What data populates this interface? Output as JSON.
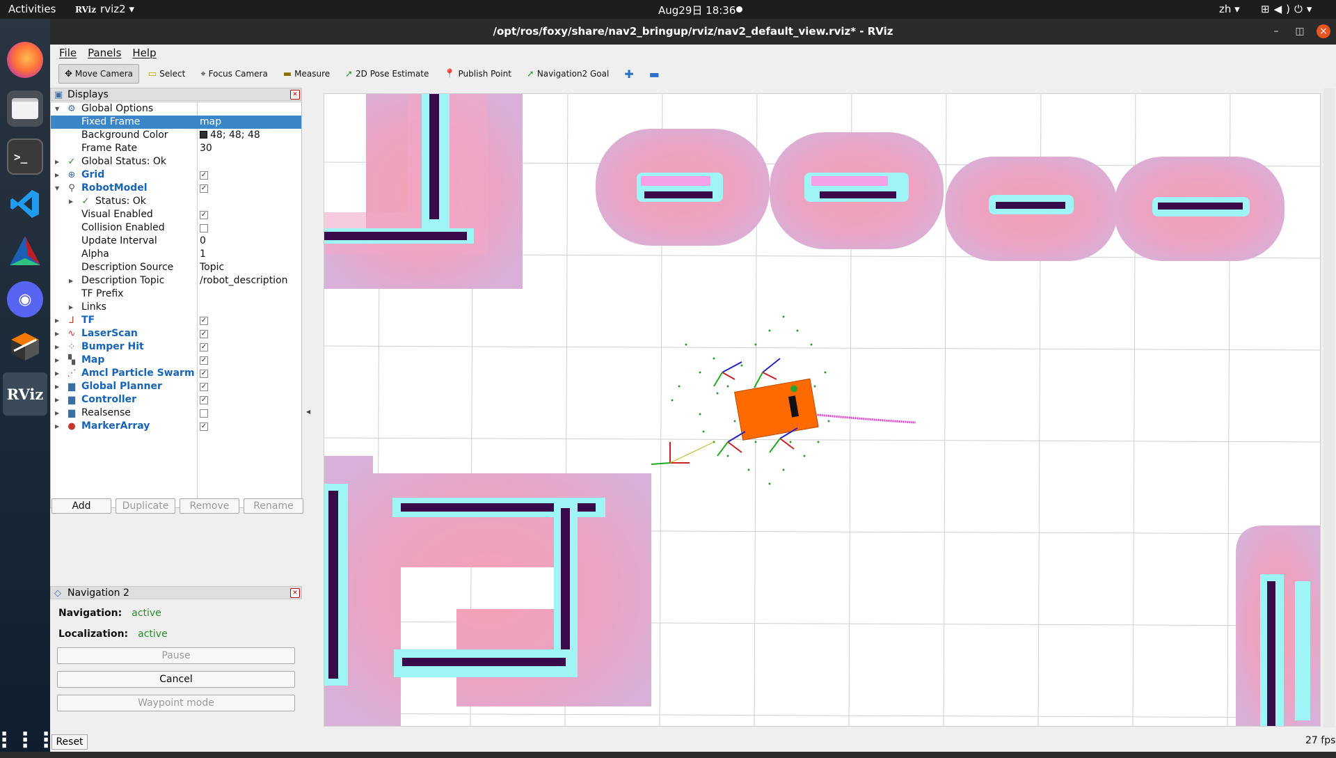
{
  "topbar": {
    "activities": "Activities",
    "app_name": "rviz2",
    "app_logo": "RViz",
    "clock": "Aug29日  18:36",
    "lang": "zh",
    "tray_icons": [
      "network-icon",
      "volume-icon",
      "power-icon"
    ]
  },
  "dock": {
    "terminal_prompt": ">_",
    "rviz_label": "RViz",
    "discord_glyph": "◉",
    "apps_glyph": "⋮⋮⋮"
  },
  "window": {
    "title": "/opt/ros/foxy/share/nav2_bringup/rviz/nav2_default_view.rviz* - RViz"
  },
  "menu": [
    "File",
    "Panels",
    "Help"
  ],
  "toolbar": [
    {
      "label": "Move Camera",
      "icon": "move-camera-icon",
      "active": true
    },
    {
      "label": "Select",
      "icon": "select-icon"
    },
    {
      "label": "Focus Camera",
      "icon": "focus-camera-icon"
    },
    {
      "label": "Measure",
      "icon": "measure-icon"
    },
    {
      "label": "2D Pose Estimate",
      "icon": "pose-estimate-icon"
    },
    {
      "label": "Publish Point",
      "icon": "publish-point-icon"
    },
    {
      "label": "Navigation2 Goal",
      "icon": "nav-goal-icon"
    }
  ],
  "displays": {
    "title": "Displays",
    "rows": [
      {
        "label": "Global Options",
        "value": ""
      },
      {
        "label": "Fixed Frame",
        "value": "map"
      },
      {
        "label": "Background Color",
        "value": "48; 48; 48"
      },
      {
        "label": "Frame Rate",
        "value": "30"
      },
      {
        "label": "Global Status: Ok",
        "value": ""
      },
      {
        "label": "Grid",
        "value": ""
      },
      {
        "label": "RobotModel",
        "value": ""
      },
      {
        "label": "Status: Ok",
        "value": ""
      },
      {
        "label": "Visual Enabled",
        "value": ""
      },
      {
        "label": "Collision Enabled",
        "value": ""
      },
      {
        "label": "Update Interval",
        "value": "0"
      },
      {
        "label": "Alpha",
        "value": "1"
      },
      {
        "label": "Description Source",
        "value": "Topic"
      },
      {
        "label": "Description Topic",
        "value": "/robot_description"
      },
      {
        "label": "TF Prefix",
        "value": ""
      },
      {
        "label": "Links",
        "value": ""
      },
      {
        "label": "TF",
        "value": ""
      },
      {
        "label": "LaserScan",
        "value": ""
      },
      {
        "label": "Bumper Hit",
        "value": ""
      },
      {
        "label": "Map",
        "value": ""
      },
      {
        "label": "Amcl Particle Swarm",
        "value": ""
      },
      {
        "label": "Global Planner",
        "value": ""
      },
      {
        "label": "Controller",
        "value": ""
      },
      {
        "label": "Realsense",
        "value": ""
      },
      {
        "label": "MarkerArray",
        "value": ""
      }
    ],
    "buttons": {
      "add": "Add",
      "duplicate": "Duplicate",
      "remove": "Remove",
      "rename": "Rename"
    }
  },
  "navigation": {
    "title": "Navigation 2",
    "nav_label": "Navigation:",
    "nav_status": "active",
    "loc_label": "Localization:",
    "loc_status": "active",
    "pause": "Pause",
    "cancel": "Cancel",
    "waypoint": "Waypoint mode"
  },
  "footer": {
    "reset": "Reset",
    "fps": "27 fps"
  },
  "colors": {
    "accent": "#e95420",
    "selection": "#3b86c7",
    "costmap": "#e8a6c8",
    "inflation": "#9ff5f5",
    "obstacle": "#3a0b4a",
    "robot": "#ff6a00"
  }
}
